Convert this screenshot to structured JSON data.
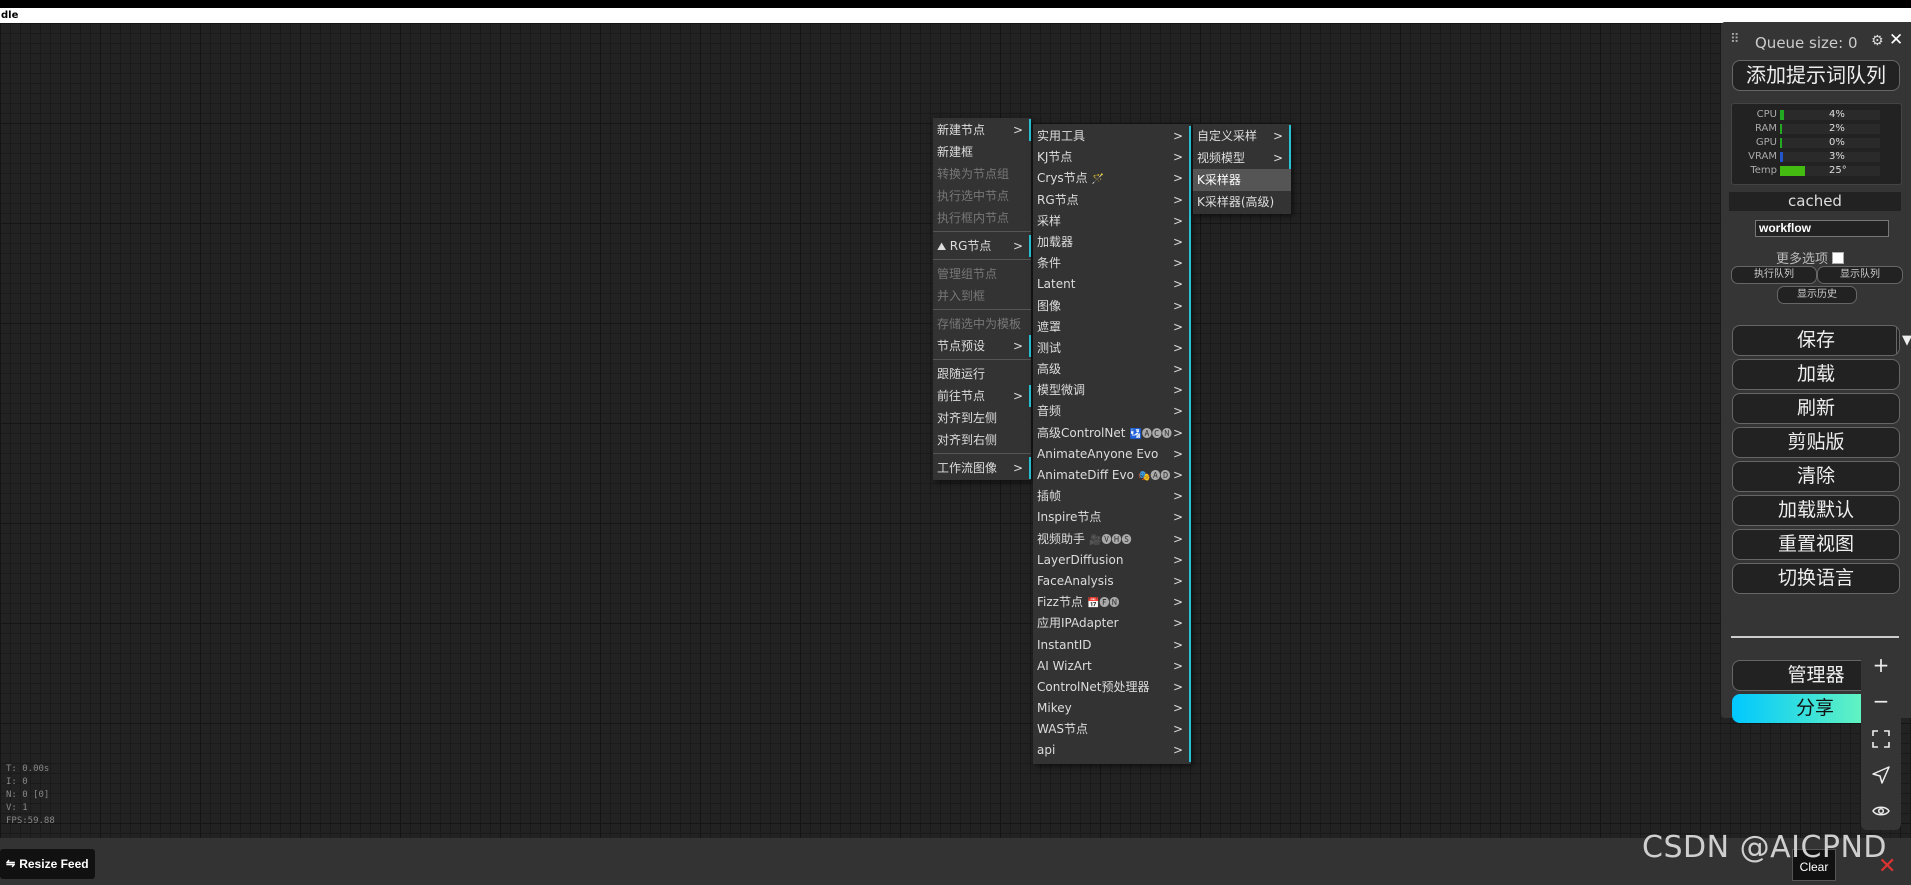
{
  "app": {
    "title": "dle"
  },
  "stats": {
    "t": "T: 0.00s",
    "i": "I: 0",
    "n": "N: 0 [0]",
    "v": "V: 1",
    "fps": "FPS:59.88"
  },
  "context_menu": {
    "items": [
      {
        "label": "新建节点",
        "sub": true,
        "disabled": false
      },
      {
        "label": "新建框",
        "sub": false,
        "disabled": false
      },
      {
        "label": "转换为节点组",
        "sub": false,
        "disabled": true
      },
      {
        "label": "执行选中节点",
        "sub": false,
        "disabled": true
      },
      {
        "label": "执行框内节点",
        "sub": false,
        "disabled": true
      },
      {
        "label": "RG节点",
        "sub": true,
        "disabled": false,
        "sep_before": true
      },
      {
        "label": "管理组节点",
        "sub": false,
        "disabled": true,
        "sep_before": true
      },
      {
        "label": "并入到框",
        "sub": false,
        "disabled": true
      },
      {
        "label": "存储选中为模板",
        "sub": false,
        "disabled": true,
        "sep_before": true
      },
      {
        "label": "节点预设",
        "sub": true,
        "disabled": false
      },
      {
        "label": "跟随运行",
        "sub": false,
        "disabled": false,
        "sep_before": true
      },
      {
        "label": "前往节点",
        "sub": true,
        "disabled": false
      },
      {
        "label": "对齐到左侧",
        "sub": false,
        "disabled": false
      },
      {
        "label": "对齐到右侧",
        "sub": false,
        "disabled": false
      },
      {
        "label": "工作流图像",
        "sub": true,
        "disabled": false,
        "sep_before": true
      }
    ]
  },
  "node_menu": {
    "items": [
      {
        "label": "实用工具"
      },
      {
        "label": "KJ节点"
      },
      {
        "label": "Crys节点",
        "badge": "🪄"
      },
      {
        "label": "RG节点"
      },
      {
        "label": "采样"
      },
      {
        "label": "加载器"
      },
      {
        "label": "条件"
      },
      {
        "label": "Latent"
      },
      {
        "label": "图像"
      },
      {
        "label": "遮罩"
      },
      {
        "label": "测试"
      },
      {
        "label": "高级"
      },
      {
        "label": "模型微调"
      },
      {
        "label": "音频"
      },
      {
        "label": "高级ControlNet",
        "badge": "🛂🅐🅒🅝"
      },
      {
        "label": "AnimateAnyone Evo"
      },
      {
        "label": "AnimateDiff Evo",
        "badge": "🎭🅐🅓"
      },
      {
        "label": "插帧"
      },
      {
        "label": "Inspire节点"
      },
      {
        "label": "视频助手",
        "badge": "🎥🅥🅗🅢"
      },
      {
        "label": "LayerDiffusion"
      },
      {
        "label": "FaceAnalysis"
      },
      {
        "label": "Fizz节点",
        "badge": "📅🅕🅝"
      },
      {
        "label": "应用IPAdapter"
      },
      {
        "label": "InstantID"
      },
      {
        "label": "AI WizArt"
      },
      {
        "label": "ControlNet预处理器"
      },
      {
        "label": "Mikey"
      },
      {
        "label": "WAS节点"
      },
      {
        "label": "api"
      }
    ]
  },
  "sampling_menu": {
    "items": [
      {
        "label": "自定义采样",
        "sub": true
      },
      {
        "label": "视频模型",
        "sub": true
      },
      {
        "label": "K采样器",
        "sub": false,
        "highlighted": true
      },
      {
        "label": "K采样器(高级)",
        "sub": false
      }
    ]
  },
  "panel": {
    "queue_size": "Queue size: 0",
    "queue_prompt": "添加提示词队列",
    "monitor": [
      {
        "label": "CPU",
        "value": "4%",
        "fraction": 0.04,
        "color": "#22aa22"
      },
      {
        "label": "RAM",
        "value": "2%",
        "fraction": 0.02,
        "color": "#22aa22"
      },
      {
        "label": "GPU",
        "value": "0%",
        "fraction": 0.0,
        "color": "#22aa22"
      },
      {
        "label": "VRAM",
        "value": "3%",
        "fraction": 0.03,
        "color": "#2255cc"
      },
      {
        "label": "Temp",
        "value": "25°",
        "fraction": 0.25,
        "color": "#44bb11"
      }
    ],
    "status": "cached",
    "workflow_name": "workflow",
    "more_options": "更多选项",
    "execute_queue": "执行队列",
    "show_queue": "显示队列",
    "show_history": "显示历史",
    "save": "保存",
    "load": "加载",
    "refresh": "刷新",
    "clipspace": "剪贴版",
    "clear": "清除",
    "load_default": "加载默认",
    "reset_view": "重置视图",
    "switch_language": "切换语言",
    "manager": "管理器",
    "share": "分享"
  },
  "bottom": {
    "resize_feed": "Resize Feed",
    "clear": "Clear",
    "watermark": "CSDN @AICPND"
  },
  "icons": {
    "drag": "drag-handle-icon",
    "gear": "gear-icon",
    "close": "close-icon",
    "zoom_in": "plus-icon",
    "zoom_out": "minus-icon",
    "fit": "fit-view-icon",
    "locate": "locate-icon",
    "visibility": "eye-icon"
  },
  "colors": {
    "accent": "#27c2d6",
    "share_start": "#00c8ff",
    "share_end": "#7dffb0",
    "close_red": "#dd3333"
  }
}
